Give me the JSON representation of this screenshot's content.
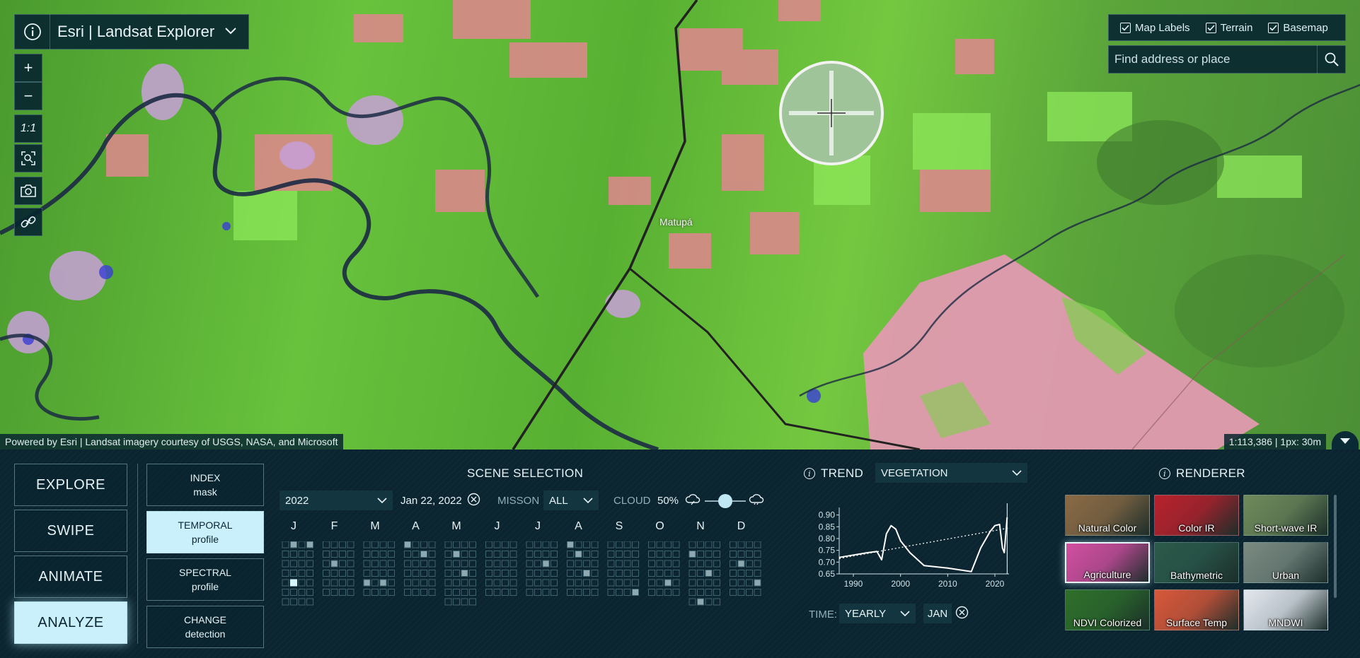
{
  "app": {
    "title": "Esri | Landsat Explorer"
  },
  "map": {
    "zoom_in": "+",
    "zoom_out": "−",
    "scale_one": "1:1",
    "city_label": "Matupá",
    "attribution": "Powered by Esri | Landsat imagery courtesy of USGS, NASA, and Microsoft",
    "scale_text": "1:113,386 | 1px: 30m"
  },
  "layer_toggles": [
    {
      "label": "Map Labels",
      "checked": true
    },
    {
      "label": "Terrain",
      "checked": true
    },
    {
      "label": "Basemap",
      "checked": true
    }
  ],
  "search": {
    "placeholder": "Find address or place"
  },
  "modes": [
    "EXPLORE",
    "SWIPE",
    "ANIMATE",
    "ANALYZE"
  ],
  "active_mode": "ANALYZE",
  "analyze_tools": [
    {
      "line1": "INDEX",
      "line2": "mask"
    },
    {
      "line1": "TEMPORAL",
      "line2": "profile"
    },
    {
      "line1": "SPECTRAL",
      "line2": "profile"
    },
    {
      "line1": "CHANGE",
      "line2": "detection"
    }
  ],
  "scene_selection": {
    "heading": "SCENE SELECTION",
    "year": "2022",
    "date": "Jan 22, 2022",
    "mission_label": "MISSON",
    "mission_value": "ALL",
    "cloud_label": "CLOUD",
    "cloud_value": "50%",
    "cloud_fraction": 0.5,
    "months": [
      "J",
      "F",
      "M",
      "A",
      "M",
      "J",
      "J",
      "A",
      "S",
      "O",
      "N",
      "D"
    ]
  },
  "trend": {
    "heading": "TREND",
    "index": "VEGETATION",
    "time_label": "TIME:",
    "time_value": "YEARLY",
    "month_value": "JAN"
  },
  "chart_data": {
    "type": "line",
    "title": "",
    "xlabel": "",
    "ylabel": "",
    "x_ticks": [
      1990,
      2000,
      2010,
      2020
    ],
    "y_ticks": [
      0.65,
      0.7,
      0.75,
      0.8,
      0.85,
      0.9
    ],
    "xlim": [
      1987,
      2023
    ],
    "ylim": [
      0.65,
      0.92
    ],
    "series": [
      {
        "x": [
          1987,
          1990,
          1993,
          1995,
          1996,
          1997,
          1998,
          1999,
          2000,
          2002,
          2005,
          2010,
          2015,
          2017,
          2019,
          2020,
          2021,
          2021.6,
          2022,
          2022.6
        ],
        "values": [
          0.72,
          0.73,
          0.74,
          0.745,
          0.71,
          0.82,
          0.855,
          0.84,
          0.79,
          0.74,
          0.685,
          0.675,
          0.66,
          0.76,
          0.83,
          0.855,
          0.86,
          0.76,
          0.74,
          0.89
        ]
      },
      {
        "x": [
          1987,
          2023
        ],
        "values": [
          0.715,
          0.845
        ],
        "style": "dotted"
      }
    ]
  },
  "renderer": {
    "heading": "RENDERER",
    "tiles": [
      {
        "label": "Natural Color",
        "color": "#8a6a44"
      },
      {
        "label": "Color IR",
        "color": "#b8222c"
      },
      {
        "label": "Short-wave IR",
        "color": "#6f8a5a"
      },
      {
        "label": "Agriculture",
        "color": "#d24fa0"
      },
      {
        "label": "Bathymetric",
        "color": "#2c5a4a"
      },
      {
        "label": "Urban",
        "color": "#7a8a80"
      },
      {
        "label": "NDVI Colorized",
        "color": "#2f6f2a"
      },
      {
        "label": "Surface Temp",
        "color": "#d8583a"
      },
      {
        "label": "MNDWI",
        "color": "#e4e8ee"
      }
    ],
    "active": "Agriculture"
  }
}
